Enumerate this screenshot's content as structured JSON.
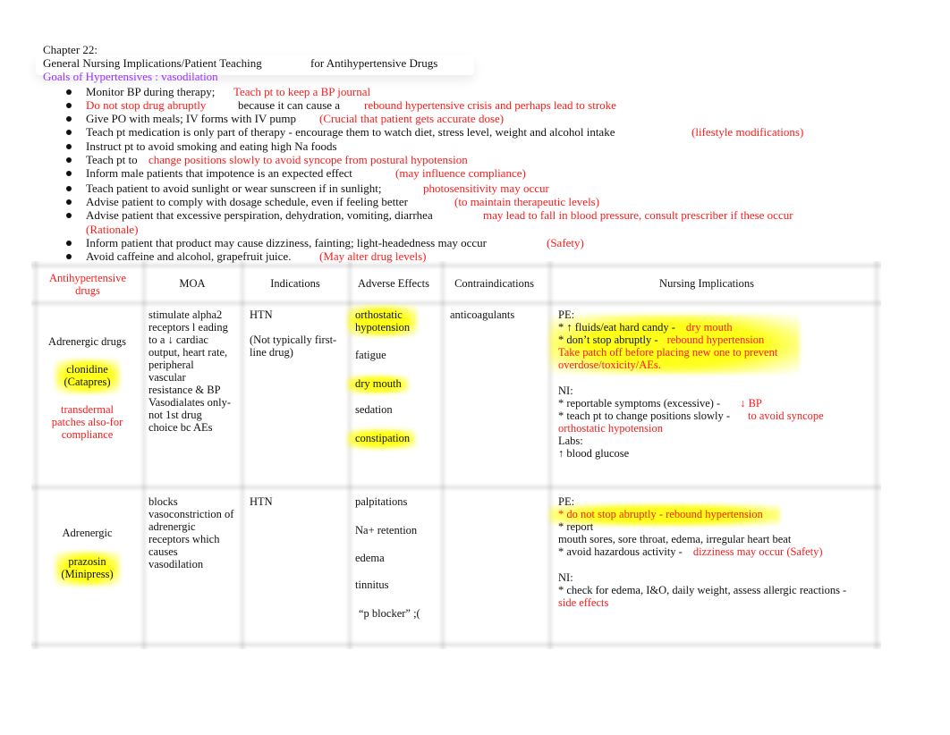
{
  "header": {
    "chapter": "Chapter 22:",
    "title_part1": "General   Nursing Implications/Patient Teaching",
    "title_part2": "for Antihypertensive Drugs",
    "goals": "Goals of Hypertensives : vasodilation"
  },
  "colors": {
    "red": "#ff1a1a",
    "purple": "#9933ff",
    "highlight": "#ffff00"
  },
  "bullets": [
    {
      "black": "Monitor BP during therapy;",
      "red": "Teach pt to keep a BP journal"
    },
    {
      "red_lead": "Do not stop drug abruptly",
      "black": "because it can cause a",
      "red": "rebound hypertensive crisis and perhaps lead to stroke"
    },
    {
      "black": "Give PO with meals; IV forms with IV pump",
      "red": "(Crucial that patient gets accurate dose)"
    },
    {
      "black": "Teach pt medication is only part of therapy - encourage them to watch diet, stress level, weight and alcohol intake",
      "red": "(lifestyle modifications)"
    },
    {
      "black": "Instruct pt to avoid smoking and eating high Na foods"
    },
    {
      "black": "Teach pt to",
      "red": "change positions slowly to avoid syncope from postural hypotension"
    },
    {
      "black": "Inform male patients that impotence is an expected effect",
      "red": "(may influence compliance)"
    },
    {
      "black": "Teach patient to avoid sunlight or wear sunscreen if in sunlight;",
      "red": "photosensitivity may occur"
    },
    {
      "black": "Advise patient to comply with dosage schedule, even if feeling better",
      "red": "(to maintain therapeutic levels)"
    },
    {
      "black": "Advise patient that excessive perspiration, dehydration, vomiting, diarrhea",
      "red": "may lead to fall in blood pressure, consult prescriber if these occur",
      "red_line2": "(Rationale)"
    },
    {
      "black": "Inform patient that product may cause dizziness, fainting; light-headedness may occur",
      "red": "(Safety)"
    },
    {
      "black": "Avoid caffeine and alcohol, grapefruit juice.",
      "red": "(May alter drug levels)"
    }
  ],
  "table": {
    "headers": {
      "drugs_line1": "Antihypertensive",
      "drugs_line2": "drugs",
      "moa": "MOA",
      "indications": "Indications",
      "adverse": "Adverse Effects",
      "contra": "Contraindications",
      "nursing": "Nursing Implications"
    },
    "rows": [
      {
        "class": "Adrenergic drugs",
        "drug_line1": "clonidine",
        "drug_line2": "(Catapres)",
        "note": [
          "transdermal",
          "patches also-for",
          "compliance"
        ],
        "moa": [
          "stimulate alpha2",
          "receptors l  eading",
          "to a ↓ cardiac",
          "output, heart rate,",
          "peripheral",
          "vascular",
          "resistance & BP",
          "Vasodialates only-",
          "not 1st drug",
          "choice bc AEs"
        ],
        "indications": [
          "HTN",
          "",
          "(Not typically first-",
          "line drug)"
        ],
        "adverse": [
          "orthostatic hypotension",
          "fatigue",
          "dry mouth",
          "sedation",
          "constipation"
        ],
        "adverse_line1": "orthostatic",
        "adverse_line2": "hypotension",
        "contra": "anticoagulants",
        "nursing": {
          "pe_label": "PE:",
          "pe1_black": "* ↑ fluids/eat hard candy -",
          "pe1_red": "dry mouth",
          "pe2_black": "* don’t stop abruptly -",
          "pe2_red": "rebound hypertension",
          "pe3_red_line1": "Take patch off before placing new one to prevent",
          "pe3_red_line2": "overdose/toxicity/AEs.",
          "ni_label": "NI:",
          "ni1_black": "* reportable symptoms (excessive) -",
          "ni1_red": "↓ BP",
          "ni2_black": "* teach pt to change positions slowly -",
          "ni2_red": "to avoid syncope",
          "ni3_red": "orthostatic hypotension",
          "labs_label": "Labs:",
          "labs1": "↑ blood glucose"
        }
      },
      {
        "class": "Adrenergic",
        "drug_line1": "prazosin",
        "drug_line2": "(Minipress)",
        "moa": [
          "blocks",
          "vasoconstriction of",
          "adrenergic",
          "receptors which",
          "causes",
          "vasodilation"
        ],
        "indications": [
          "HTN"
        ],
        "adverse": [
          "palpitations",
          "Na+ retention",
          "edema",
          "tinnitus",
          "“p blocker” ;("
        ],
        "contra": "",
        "nursing": {
          "pe_label": "PE:",
          "pe1_red": "* do not stop abruptly - rebound hypertension",
          "pe2_black": "* report",
          "pe3_black": "mouth sores, sore throat, edema, irregular heart beat",
          "pe4_black": "* avoid hazardous activity -",
          "pe4_red": "dizziness may occur (Safety)",
          "ni_label": "NI:",
          "ni1_black": "* check for edema, I&O, daily weight, assess allergic reactions -",
          "ni1_red": "side effects"
        }
      }
    ]
  }
}
